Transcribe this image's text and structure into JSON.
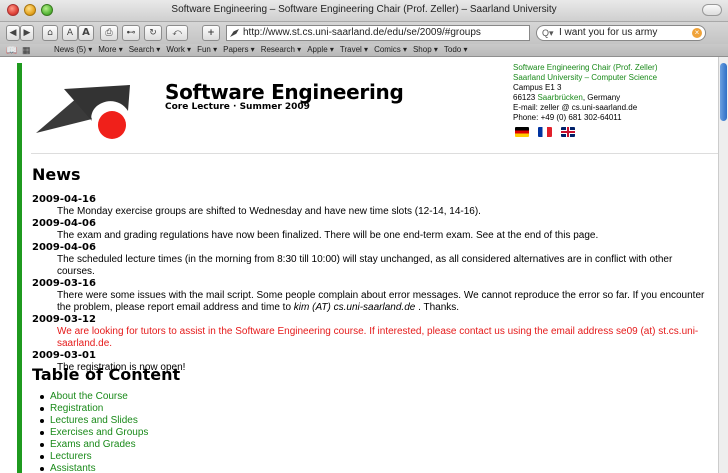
{
  "window": {
    "title": "Software Engineering – Software Engineering Chair (Prof. Zeller) – Saarland University"
  },
  "toolbar": {
    "back_icon": "back-icon",
    "forward_icon": "forward-icon",
    "home_icon": "home-icon",
    "font_smaller": "A",
    "font_larger": "A",
    "url": "http://www.st.cs.uni-saarland.de/edu/se/2009/#groups",
    "search_query": "I want you for us army"
  },
  "bookmarks": {
    "items": [
      "News (5) ▾",
      "More ▾",
      "Search ▾",
      "Work ▾",
      "Fun ▾",
      "Papers ▾",
      "Research ▾",
      "Apple ▾",
      "Travel ▾",
      "Comics ▾",
      "Shop ▾",
      "Todo ▾"
    ]
  },
  "header": {
    "title": "Software Engineering",
    "subtitle": "Core Lecture · Summer 2009",
    "contact": {
      "chair": "Software Engineering Chair (Prof. Zeller)",
      "university": "Saarland University – Computer Science",
      "campus": "Campus E1 3",
      "postcode": "66123 ",
      "city": "Saarbrücken",
      "country": ", Germany",
      "email": "E-mail: zeller @ cs.uni-saarland.de",
      "phone": "Phone: +49 (0) 681 302-64011"
    }
  },
  "news": {
    "heading": "News",
    "items": [
      {
        "date": "2009-04-16",
        "text": "The Monday exercise groups are shifted to Wednesday and have new time slots (12-14, 14-16)."
      },
      {
        "date": "2009-04-06",
        "text": "The exam and grading regulations have now been finalized. There will be one end-term exam. See at the end of this page."
      },
      {
        "date": "2009-04-06",
        "text": "The scheduled lecture times (in the morning from 8:30 till 10:00) will stay unchanged, as all considered alternatives are in conflict with other courses."
      },
      {
        "date": "2009-03-16",
        "text": "There were some issues with the mail script. Some people complain about error messages. We cannot reproduce the error so far. If you encounter the problem, please report email address and time to ",
        "email": "kim (AT) cs.uni-saarland.de",
        "tail": " . Thanks."
      },
      {
        "date": "2009-03-12",
        "text": "We are looking for tutors to assist in the Software Engineering course. If interested, please contact us using the email address se09 (at) st.cs.uni-saarland.de."
      },
      {
        "date": "2009-03-01",
        "text": "The registration is now open!"
      }
    ]
  },
  "toc": {
    "heading": "Table of Content",
    "items": [
      "About the Course",
      "Registration",
      "Lectures and Slides",
      "Exercises and Groups",
      "Exams and Grades",
      "Lecturers",
      "Assistants"
    ]
  }
}
